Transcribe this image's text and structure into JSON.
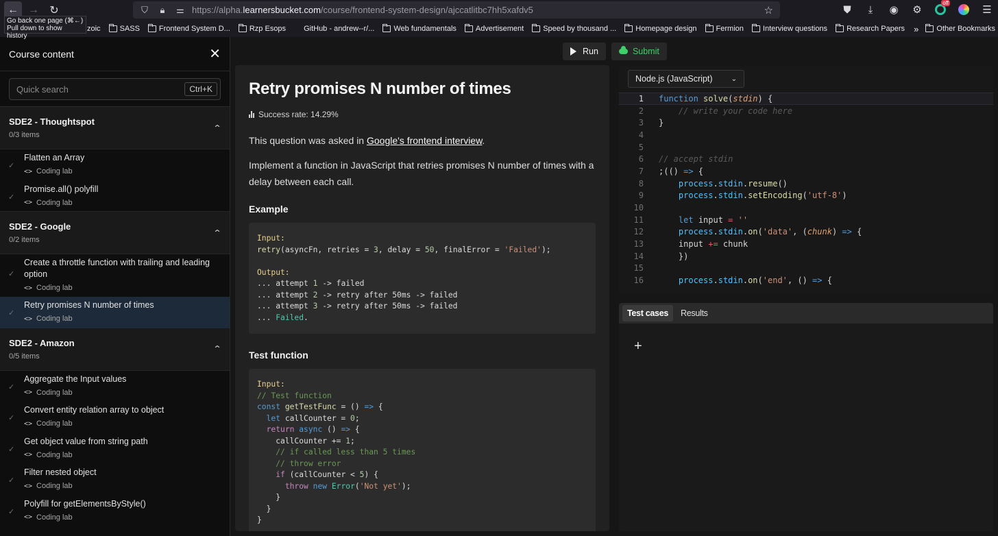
{
  "browser": {
    "url_scheme": "https://alpha.",
    "url_host": "learnersbucket.com",
    "url_path": "/course/frontend-system-design/ajccatlitbc7hh5xafdv5",
    "tooltip_line1": "Go back one page (⌘←)",
    "tooltip_line2": "Pull down to show history",
    "bookmarks": [
      "zoic",
      "SASS",
      "Frontend System D...",
      "Rzp Esops",
      "GitHub - andrew--r/...",
      "Web fundamentals",
      "Advertisement",
      "Speed by thousand ...",
      "Homepage design",
      "Fermion",
      "Interview questions",
      "Research Papers"
    ],
    "other_bookmarks": "Other Bookmarks",
    "extension_badge": "off"
  },
  "sidebar": {
    "title": "Course content",
    "search_placeholder": "Quick search",
    "search_shortcut": "Ctrl+K",
    "sections": [
      {
        "title": "SDE2 - Thoughtspot",
        "count": "0/3 items",
        "items": [
          {
            "title": "Flatten an Array",
            "type": "Coding lab"
          },
          {
            "title": "Promise.all() polyfill",
            "type": "Coding lab"
          }
        ]
      },
      {
        "title": "SDE2 - Google",
        "count": "0/2 items",
        "items": [
          {
            "title": "Create a throttle function with trailing and leading option",
            "type": "Coding lab"
          },
          {
            "title": "Retry promises N number of times",
            "type": "Coding lab"
          }
        ]
      },
      {
        "title": "SDE2 - Amazon",
        "count": "0/5 items",
        "items": [
          {
            "title": "Aggregate the Input values",
            "type": "Coding lab"
          },
          {
            "title": "Convert entity relation array to object",
            "type": "Coding lab"
          },
          {
            "title": "Get object value from string path",
            "type": "Coding lab"
          },
          {
            "title": "Filter nested object",
            "type": "Coding lab"
          },
          {
            "title": "Polyfill for getElementsByStyle()",
            "type": "Coding lab"
          }
        ]
      }
    ]
  },
  "actions": {
    "run": "Run",
    "submit": "Submit"
  },
  "question": {
    "title": "Retry promises N number of times",
    "success_rate": "Success rate: 14.29%",
    "asked_prefix": "This question was asked in ",
    "asked_link": "Google's frontend interview",
    "asked_suffix": ".",
    "description": "Implement a function in JavaScript that retries promises N number of times with a delay between each call.",
    "example_heading": "Example",
    "test_heading": "Test function"
  },
  "editor": {
    "language": "Node.js (JavaScript)"
  },
  "tests": {
    "tab_cases": "Test cases",
    "tab_results": "Results",
    "add_symbol": "+"
  },
  "colors": {
    "accent_green": "#3ecf6b",
    "active_item_bg": "#1d2a3a"
  }
}
